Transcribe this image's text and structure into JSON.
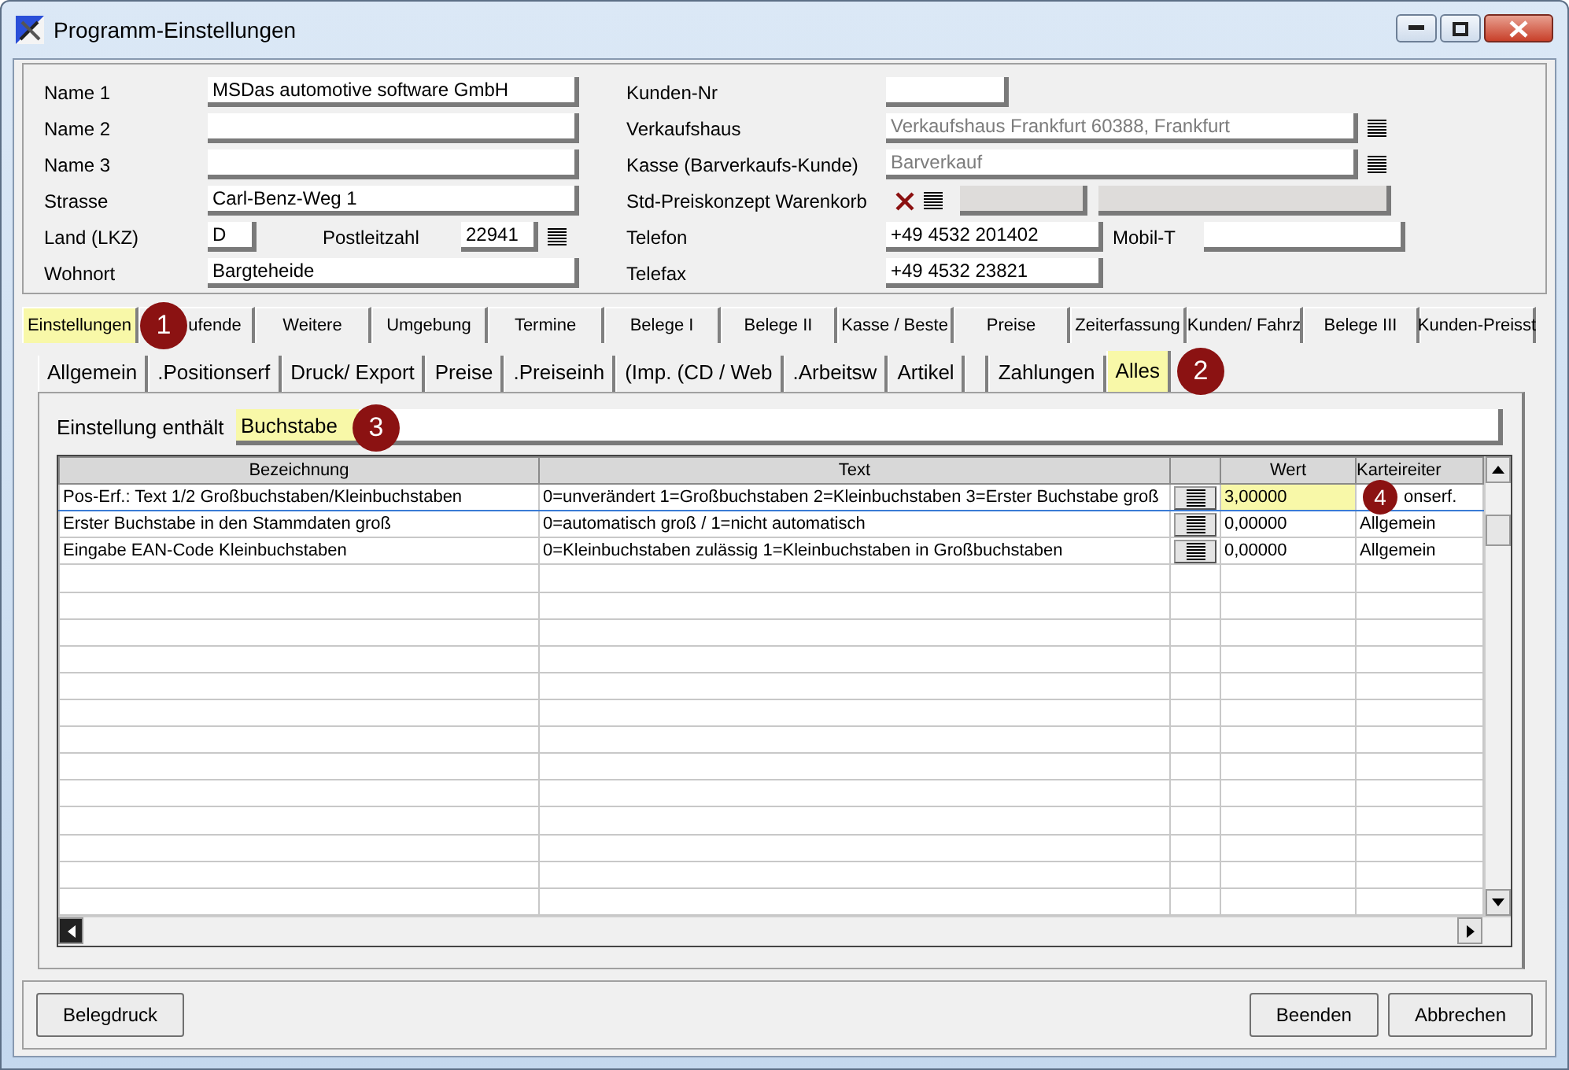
{
  "window": {
    "title": "Programm-Einstellungen"
  },
  "address": {
    "left_rows": [
      {
        "kind": "text",
        "label": "Name 1",
        "value": "MSDas automotive software GmbH"
      },
      {
        "kind": "text",
        "label": "Name 2"
      },
      {
        "kind": "text",
        "label": "Name 3"
      },
      {
        "kind": "text",
        "label": "Strasse",
        "value": "Carl-Benz-Weg 1"
      },
      {
        "kind": "country",
        "label": "Land (LKZ)",
        "value": "D",
        "second_label": "Postleitzahl",
        "second_value": "22941"
      },
      {
        "kind": "text",
        "label": "Wohnort",
        "value": "Bargteheide"
      }
    ],
    "right_rows": [
      {
        "kind": "short",
        "label": "Kunden-Nr"
      },
      {
        "kind": "lookup",
        "label": "Verkaufshaus",
        "value": "Verkaufshaus Frankfurt 60388, Frankfurt",
        "disabled": true
      },
      {
        "kind": "lookup",
        "label": "Kasse (Barverkaufs-Kunde)",
        "value": "Barverkauf",
        "disabled": true
      },
      {
        "kind": "concept",
        "label": "Std-Preiskonzept Warenkorb"
      },
      {
        "kind": "phone",
        "label": "Telefon",
        "value": "+49 4532 201402",
        "second_label": "Mobil-T"
      },
      {
        "kind": "medium",
        "label": "Telefax",
        "value": "+49 4532 23821"
      }
    ]
  },
  "main_tabs": [
    {
      "label": "Einstellungen",
      "selected": true
    },
    {
      "label": "ufende",
      "selected": false,
      "callout": "1"
    },
    {
      "label": "Weitere",
      "selected": false
    },
    {
      "label": "Umgebung",
      "selected": false
    },
    {
      "label": "Termine",
      "selected": false
    },
    {
      "label": "Belege I",
      "selected": false
    },
    {
      "label": "Belege II",
      "selected": false
    },
    {
      "label": "Kasse / Beste",
      "selected": false
    },
    {
      "label": "Preise",
      "selected": false
    },
    {
      "label": "Zeiterfassung",
      "selected": false
    },
    {
      "label": "Kunden/ Fahrz",
      "selected": false
    },
    {
      "label": "Belege III",
      "selected": false
    },
    {
      "label": "Kunden-Preisst",
      "selected": false
    }
  ],
  "sub_tabs": [
    {
      "label": "Allgemein",
      "selected": false
    },
    {
      "label": ".Positionserf",
      "selected": false
    },
    {
      "label": "Druck/ Export",
      "selected": false
    },
    {
      "label": "Preise",
      "selected": false
    },
    {
      "label": ".Preiseinh",
      "selected": false
    },
    {
      "label": "(Imp. (CD / Web",
      "selected": false
    },
    {
      "label": ".Arbeitsw",
      "selected": false
    },
    {
      "label": "Artikel",
      "selected": false
    },
    {
      "selected": false
    },
    {
      "label": "Zahlungen",
      "selected": false
    },
    {
      "label": "Alles",
      "selected": true,
      "callout": "2"
    }
  ],
  "filter": {
    "label": "Einstellung enthält",
    "value": "Buchstabe",
    "callout": "3"
  },
  "table": {
    "columns": [
      "Bezeichnung",
      "Text",
      "Wert",
      "Karteireiter"
    ],
    "rows": [
      {
        "bezeichnung": "Pos-Erf.: Text 1/2 Großbuchstaben/Kleinbuchstaben",
        "text": "0=unverändert 1=Großbuchstaben 2=Kleinbuchstaben 3=Erster Buchstabe groß",
        "wert": "3,00000",
        "karteireiter": "onserf.",
        "selected": true,
        "callout": "4"
      },
      {
        "bezeichnung": "Erster Buchstabe in den Stammdaten groß",
        "text": "0=automatisch groß / 1=nicht automatisch",
        "wert": "0,00000",
        "karteireiter": "Allgemein",
        "selected": false
      },
      {
        "bezeichnung": "Eingabe EAN-Code Kleinbuchstaben",
        "text": "0=Kleinbuchstaben zulässig 1=Kleinbuchstaben in Großbuchstaben",
        "wert": "0,00000",
        "karteireiter": "Allgemein",
        "selected": false
      }
    ]
  },
  "buttons": {
    "left": [
      "Belegdruck"
    ],
    "right": [
      "Beenden",
      "Abbrechen"
    ]
  }
}
